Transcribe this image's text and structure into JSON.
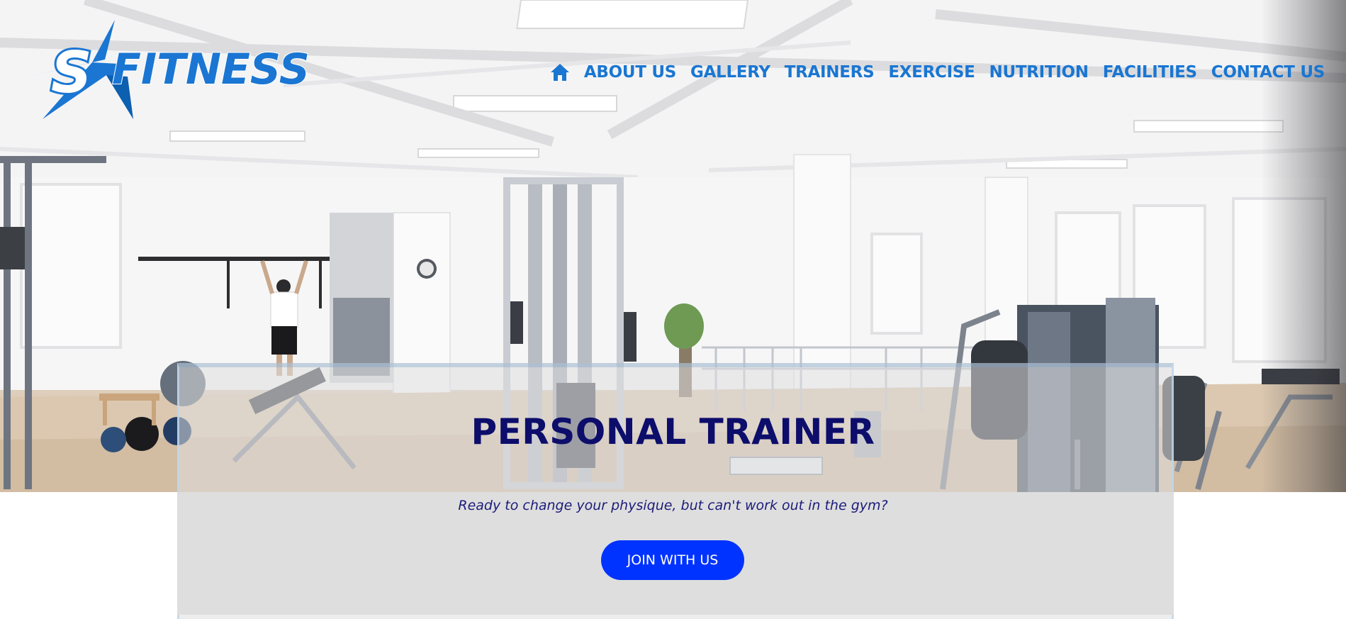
{
  "brand": {
    "logo_text": "FITNESS",
    "logo_letter": "S",
    "logo_color": "#1a76d2"
  },
  "nav": {
    "home_icon": "home-icon",
    "items": [
      {
        "label": "ABOUT US"
      },
      {
        "label": "GALLERY"
      },
      {
        "label": "TRAINERS"
      },
      {
        "label": "EXERCISE"
      },
      {
        "label": "NUTRITION"
      },
      {
        "label": "FACILITIES"
      },
      {
        "label": "CONTACT US"
      }
    ],
    "color": "#1a76d2"
  },
  "hero": {
    "title": "PERSONAL TRAINER",
    "subtitle": "Ready to change your physique, but can't work out in the gym?",
    "cta_label": "JOIN WITH US",
    "cta_color": "#0033ff",
    "title_color": "#0d0d6b"
  }
}
